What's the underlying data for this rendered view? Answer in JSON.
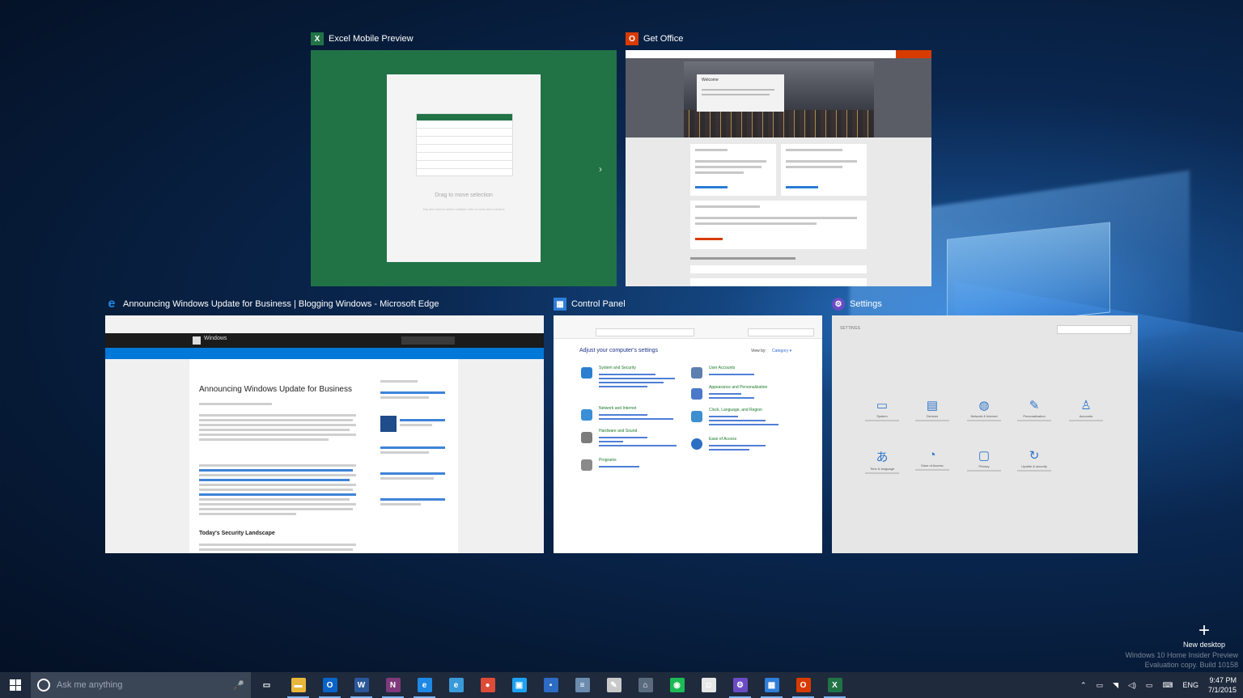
{
  "task_view": {
    "windows": [
      {
        "id": "excel",
        "title": "Excel Mobile Preview",
        "icon": "excel-icon",
        "icon_glyph": "X",
        "icon_color": "#217346",
        "content": {
          "drag_text": "Drag to move selection",
          "hint_text": "Tap and hold to select multiple cells or rows and columns"
        }
      },
      {
        "id": "office",
        "title": "Get Office",
        "icon": "office-icon",
        "icon_glyph": "O",
        "icon_color": "#d83b01",
        "content": {
          "welcome": "Welcome"
        }
      },
      {
        "id": "edge",
        "title": "Announcing Windows Update for Business | Blogging Windows - Microsoft Edge",
        "icon": "edge-icon",
        "icon_glyph": "e",
        "icon_color": "#1e88e5",
        "content": {
          "site_name": "Windows",
          "article_title": "Announcing Windows Update for Business",
          "section_heading": "Today's Security Landscape"
        }
      },
      {
        "id": "control-panel",
        "title": "Control Panel",
        "icon": "control-panel-icon",
        "icon_glyph": "▦",
        "icon_color": "#2f7ed8",
        "content": {
          "heading": "Adjust your computer's settings",
          "view_by": "View by:",
          "view_mode": "Category ▾",
          "categories": [
            {
              "name": "System and Security",
              "color": "#2a7fd0"
            },
            {
              "name": "Network and Internet",
              "color": "#3a8fd6"
            },
            {
              "name": "Hardware and Sound",
              "color": "#7c7c7c"
            },
            {
              "name": "Programs",
              "color": "#8a8a8a"
            },
            {
              "name": "User Accounts",
              "color": "#5c7fb0"
            },
            {
              "name": "Appearance and Personalization",
              "color": "#4b78c9"
            },
            {
              "name": "Clock, Language, and Region",
              "color": "#3d8fcf"
            },
            {
              "name": "Ease of Access",
              "color": "#2c6fc4"
            }
          ]
        }
      },
      {
        "id": "settings",
        "title": "Settings",
        "icon": "settings-icon",
        "icon_glyph": "⚙",
        "icon_color": "#6b4bc4",
        "content": {
          "header": "SETTINGS",
          "items": [
            {
              "name": "System",
              "glyph": "▭"
            },
            {
              "name": "Devices",
              "glyph": "▤"
            },
            {
              "name": "Network & Internet",
              "glyph": "◍"
            },
            {
              "name": "Personalization",
              "glyph": "✎"
            },
            {
              "name": "Accounts",
              "glyph": "♙"
            },
            {
              "name": "Time & language",
              "glyph": "あ"
            },
            {
              "name": "Ease of Access",
              "glyph": "◔"
            },
            {
              "name": "Privacy",
              "glyph": "▢"
            },
            {
              "name": "Update & security",
              "glyph": "↻"
            }
          ]
        }
      }
    ]
  },
  "new_desktop": {
    "label": "New desktop"
  },
  "watermark": {
    "line1": "Windows 10 Home Insider Preview",
    "line2": "Evaluation copy. Build 10158"
  },
  "taskbar": {
    "search_placeholder": "Ask me anything",
    "apps": [
      {
        "name": "task-view",
        "glyph": "▭",
        "color": "#1f2a3d",
        "active": false
      },
      {
        "name": "file-explorer",
        "glyph": "▬",
        "color": "#e8b73a",
        "active": true
      },
      {
        "name": "outlook",
        "glyph": "O",
        "color": "#0a64c8",
        "active": true
      },
      {
        "name": "word",
        "glyph": "W",
        "color": "#2b579a",
        "active": true
      },
      {
        "name": "onenote",
        "glyph": "N",
        "color": "#80397b",
        "active": true
      },
      {
        "name": "edge",
        "glyph": "e",
        "color": "#1e88e5",
        "active": true
      },
      {
        "name": "internet-explorer",
        "glyph": "e",
        "color": "#3a9ad9",
        "active": false
      },
      {
        "name": "chrome",
        "glyph": "●",
        "color": "#dd4b39",
        "active": false
      },
      {
        "name": "twitter",
        "glyph": "▣",
        "color": "#1da1f2",
        "active": false
      },
      {
        "name": "remote-desktop",
        "glyph": "▪",
        "color": "#2d6bc4",
        "active": false
      },
      {
        "name": "notepad",
        "glyph": "≡",
        "color": "#6b8cae",
        "active": false
      },
      {
        "name": "paint",
        "glyph": "✎",
        "color": "#c9c9c9",
        "active": false
      },
      {
        "name": "network",
        "glyph": "⌂",
        "color": "#5a6b80",
        "active": false
      },
      {
        "name": "spotify",
        "glyph": "◉",
        "color": "#1db954",
        "active": false
      },
      {
        "name": "store",
        "glyph": "◘",
        "color": "#e6e6e6",
        "active": false
      },
      {
        "name": "settings",
        "glyph": "⚙",
        "color": "#6b4bc4",
        "active": true
      },
      {
        "name": "control-panel",
        "glyph": "▦",
        "color": "#2f7ed8",
        "active": true
      },
      {
        "name": "get-office",
        "glyph": "O",
        "color": "#d83b01",
        "active": true
      },
      {
        "name": "excel",
        "glyph": "X",
        "color": "#217346",
        "active": true
      }
    ],
    "tray": {
      "language": "ENG",
      "time": "9:47 PM",
      "date": "7/1/2015"
    }
  }
}
